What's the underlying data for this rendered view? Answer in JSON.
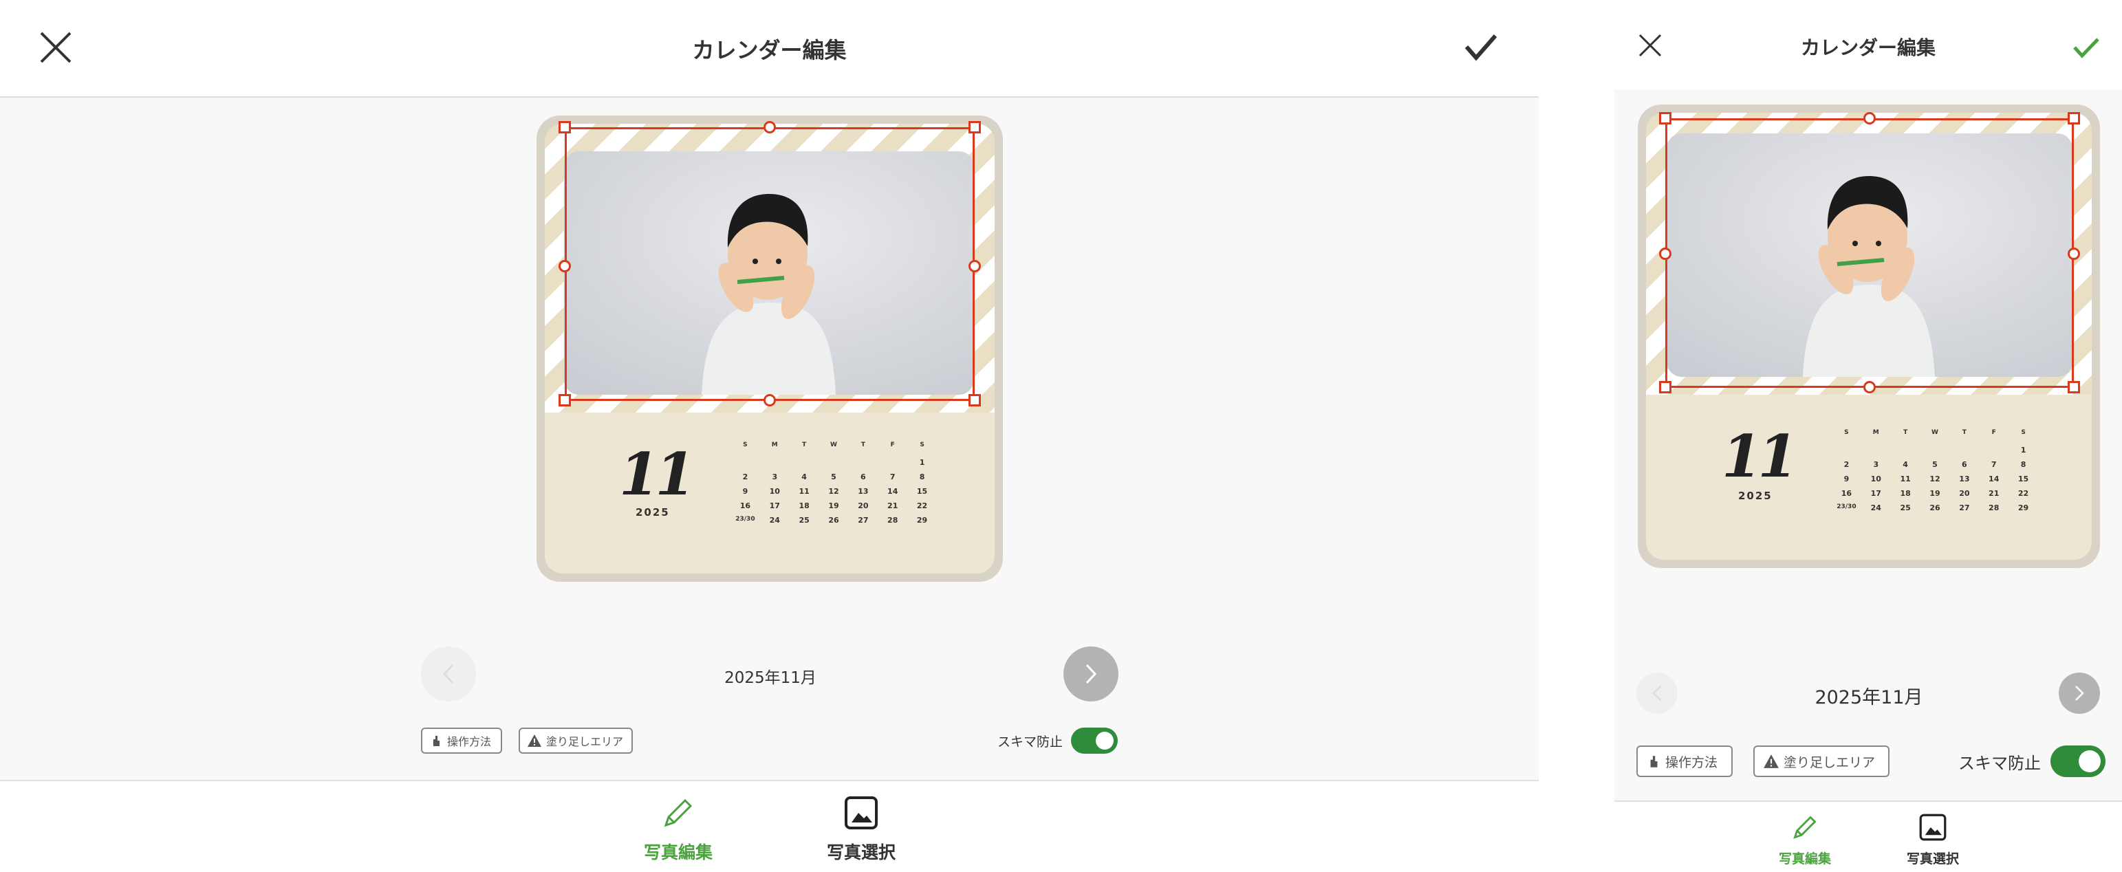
{
  "header": {
    "title": "カレンダー編集"
  },
  "calendar": {
    "month_number": "11",
    "year": "2025",
    "weekdays": [
      "S",
      "M",
      "T",
      "W",
      "T",
      "F",
      "S"
    ],
    "weeks": [
      [
        "",
        "",
        "",
        "",
        "",
        "",
        "1"
      ],
      [
        "2",
        "3",
        "4",
        "5",
        "6",
        "7",
        "8"
      ],
      [
        "9",
        "10",
        "11",
        "12",
        "13",
        "14",
        "15"
      ],
      [
        "16",
        "17",
        "18",
        "19",
        "20",
        "21",
        "22"
      ],
      [
        "23/30",
        "24",
        "25",
        "26",
        "27",
        "28",
        "29"
      ]
    ]
  },
  "navigation": {
    "current_month": "2025年11月"
  },
  "tools": {
    "how_to_label": "操作方法",
    "bleed_label": "塗り足しエリア",
    "gap_prevention_label": "スキマ防止",
    "gap_prevention_on": true
  },
  "tabs": [
    {
      "label": "写真編集",
      "active": true,
      "icon": "pencil-icon"
    },
    {
      "label": "写真選択",
      "active": false,
      "icon": "photo-icon"
    }
  ],
  "colors": {
    "accent_green": "#4aa33f",
    "toggle_green": "#2f8c3a",
    "selection_red": "#d9391c",
    "card_cream": "#ede6d2"
  }
}
